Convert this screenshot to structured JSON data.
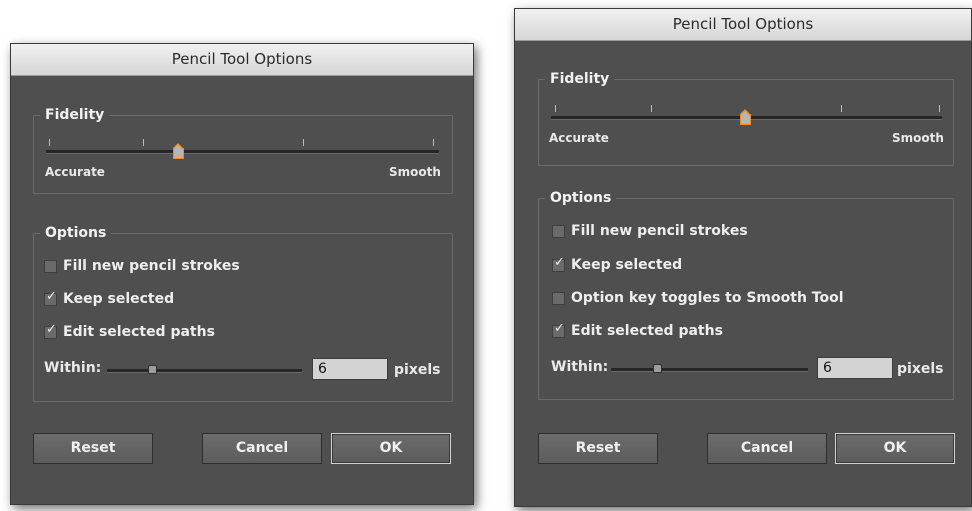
{
  "dialogs": [
    {
      "title": "Pencil Tool Options",
      "fidelity": {
        "legend": "Fidelity",
        "left_label": "Accurate",
        "right_label": "Smooth",
        "value": 0.34
      },
      "options": {
        "legend": "Options",
        "items": [
          {
            "label": "Fill new pencil strokes",
            "checked": false
          },
          {
            "label": "Keep selected",
            "checked": true
          },
          {
            "label": "Edit selected paths",
            "checked": true
          }
        ],
        "within": {
          "label": "Within:",
          "value": "6",
          "unit": "pixels",
          "slider_value": 0.24
        }
      },
      "buttons": {
        "reset": "Reset",
        "cancel": "Cancel",
        "ok": "OK"
      }
    },
    {
      "title": "Pencil Tool Options",
      "fidelity": {
        "legend": "Fidelity",
        "left_label": "Accurate",
        "right_label": "Smooth",
        "value": 0.5
      },
      "options": {
        "legend": "Options",
        "items": [
          {
            "label": "Fill new pencil strokes",
            "checked": false
          },
          {
            "label": "Keep selected",
            "checked": true
          },
          {
            "label": "Option key toggles to Smooth Tool",
            "checked": false
          },
          {
            "label": "Edit selected paths",
            "checked": true
          }
        ],
        "within": {
          "label": "Within:",
          "value": "6",
          "unit": "pixels",
          "slider_value": 0.24
        }
      },
      "buttons": {
        "reset": "Reset",
        "cancel": "Cancel",
        "ok": "OK"
      }
    }
  ],
  "colors": {
    "dialog_bg": "#4f4f4f",
    "accent_thumb": "#f08a20",
    "titlebar": "#e4e4e4"
  }
}
